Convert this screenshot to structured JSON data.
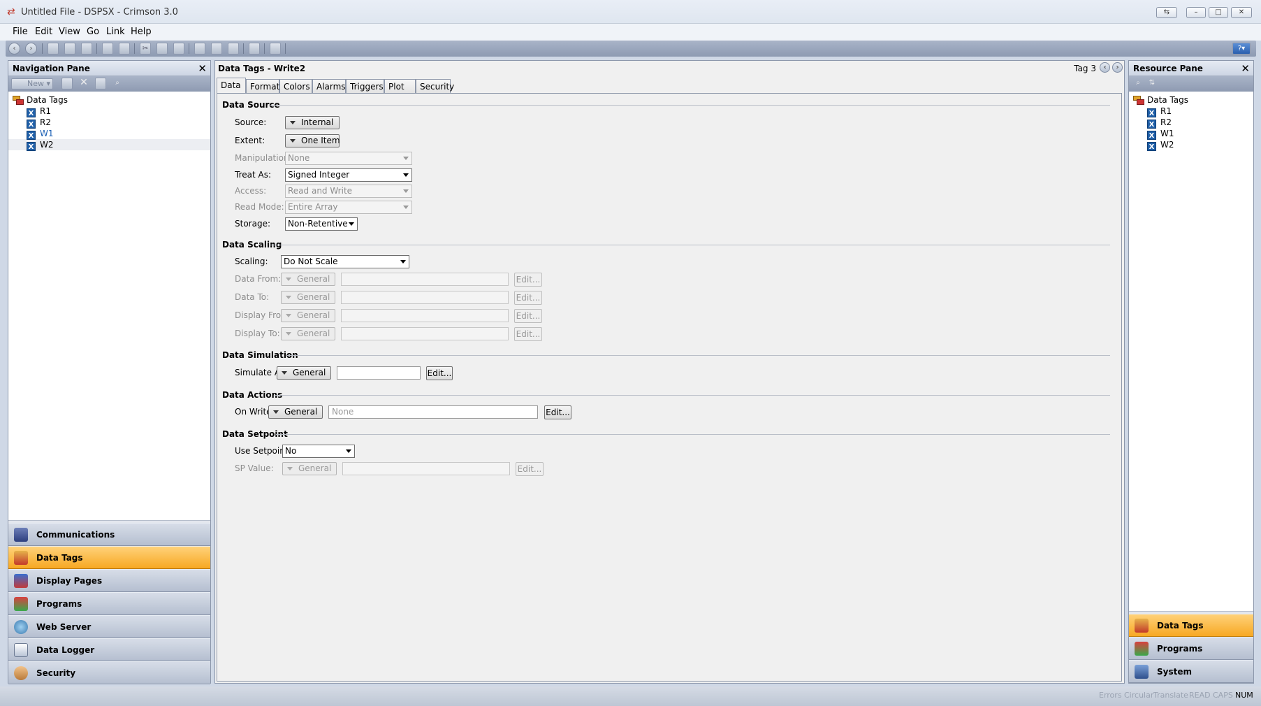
{
  "window": {
    "title": "Untitled File - DSPSX - Crimson 3.0"
  },
  "menu": [
    "File",
    "Edit",
    "View",
    "Go",
    "Link",
    "Help"
  ],
  "nav_pane": {
    "title": "Navigation Pane",
    "new_label": "New",
    "tree_root": "Data Tags",
    "tree_items": [
      "R1",
      "R2",
      "W1",
      "W2"
    ],
    "buttons": [
      "Communications",
      "Data Tags",
      "Display Pages",
      "Programs",
      "Web Server",
      "Data Logger",
      "Security"
    ],
    "active": "Data Tags"
  },
  "editor": {
    "title": "Data Tags - Write2",
    "tag_label": "Tag 3",
    "tabs": [
      "Data",
      "Format",
      "Colors",
      "Alarms",
      "Triggers",
      "Plot",
      "Security"
    ],
    "active_tab": "Data",
    "data_source": {
      "heading": "Data Source",
      "source_label": "Source:",
      "source_value": "Internal",
      "extent_label": "Extent:",
      "extent_value": "One Item",
      "manipulation_label": "Manipulation:",
      "manipulation_value": "None",
      "treat_as_label": "Treat As:",
      "treat_as_value": "Signed Integer",
      "access_label": "Access:",
      "access_value": "Read and Write",
      "read_mode_label": "Read Mode:",
      "read_mode_value": "Entire Array",
      "storage_label": "Storage:",
      "storage_value": "Non-Retentive"
    },
    "data_scaling": {
      "heading": "Data Scaling",
      "scaling_label": "Scaling:",
      "scaling_value": "Do Not Scale",
      "rows": [
        {
          "label": "Data From:",
          "type": "General",
          "edit": "Edit..."
        },
        {
          "label": "Data To:",
          "type": "General",
          "edit": "Edit..."
        },
        {
          "label": "Display From:",
          "type": "General",
          "edit": "Edit..."
        },
        {
          "label": "Display To:",
          "type": "General",
          "edit": "Edit..."
        }
      ]
    },
    "data_simulation": {
      "heading": "Data Simulation",
      "label": "Simulate As:",
      "type": "General",
      "value": "",
      "edit": "Edit..."
    },
    "data_actions": {
      "heading": "Data Actions",
      "label": "On Write:",
      "type": "General",
      "placeholder": "None",
      "edit": "Edit..."
    },
    "data_setpoint": {
      "heading": "Data Setpoint",
      "use_label": "Use Setpoint:",
      "use_value": "No",
      "sp_label": "SP Value:",
      "sp_type": "General",
      "edit": "Edit..."
    }
  },
  "resource_pane": {
    "title": "Resource Pane",
    "tree_root": "Data Tags",
    "tree_items": [
      "R1",
      "R2",
      "W1",
      "W2"
    ],
    "buttons": [
      "Data Tags",
      "Programs",
      "System"
    ],
    "active": "Data Tags"
  },
  "status": [
    "Errors",
    "Circular",
    "Translate",
    "READ",
    "CAPS",
    "NUM"
  ]
}
